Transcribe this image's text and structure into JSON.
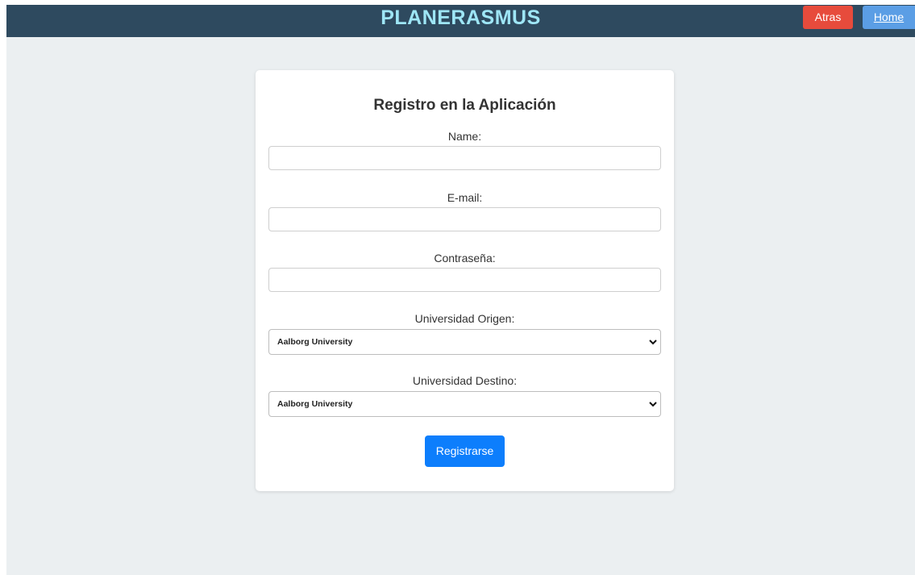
{
  "header": {
    "brand": "PLANERASMUS",
    "atras_label": "Atras",
    "home_label": "Home"
  },
  "form": {
    "title": "Registro en la Aplicación",
    "name_label": "Name:",
    "name_value": "",
    "email_label": "E-mail:",
    "email_value": "",
    "password_label": "Contraseña:",
    "password_value": "",
    "origin_label": "Universidad Origen:",
    "origin_selected": "Aalborg University",
    "destination_label": "Universidad Destino:",
    "destination_selected": "Aalborg University",
    "submit_label": "Registrarse"
  },
  "colors": {
    "navbar": "#2e4a5f",
    "brand_text": "#9ee6f6",
    "atras_button": "#e74b3c",
    "home_button": "#5b9ee5",
    "submit_button": "#0d7efc",
    "page_background": "#ebeff1"
  }
}
